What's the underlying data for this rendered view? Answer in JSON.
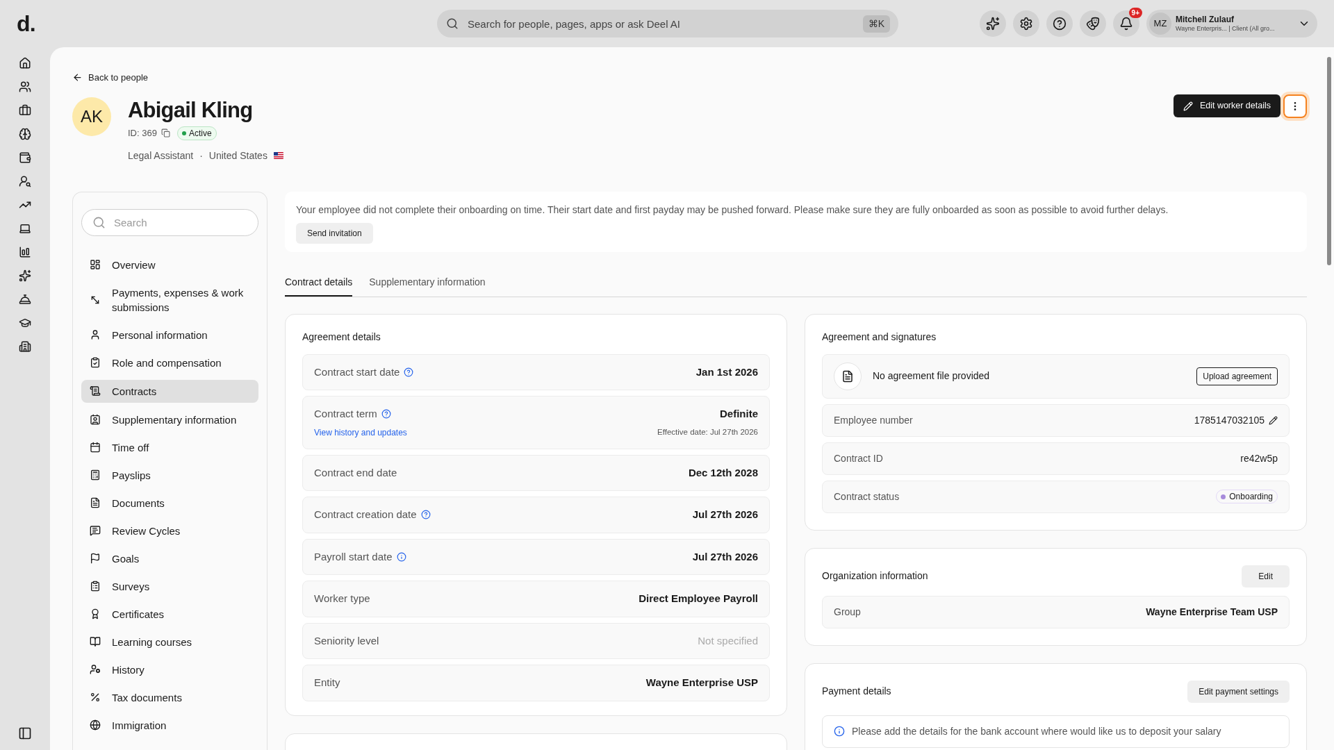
{
  "topbar": {
    "logo": "d.",
    "search_placeholder": "Search for people, pages, apps or ask Deel AI",
    "shortcut": "⌘K",
    "notification_badge": "9+",
    "user": {
      "initials": "MZ",
      "name": "Mitchell Zulauf",
      "subtitle": "Wayne Enterpris... | Client (All gro..."
    }
  },
  "header": {
    "back_link": "Back to people",
    "avatar_initials": "AK",
    "name": "Abigail Kling",
    "id": "ID: 369",
    "status": "Active",
    "role": "Legal Assistant",
    "separator": "·",
    "country": "United States",
    "edit_button": "Edit worker details"
  },
  "sidebar": {
    "search_placeholder": "Search",
    "items": [
      {
        "label": "Overview",
        "selected": false
      },
      {
        "label": "Payments, expenses & work submissions",
        "selected": false
      },
      {
        "label": "Personal information",
        "selected": false
      },
      {
        "label": "Role and compensation",
        "selected": false
      },
      {
        "label": "Contracts",
        "selected": true
      },
      {
        "label": "Supplementary information",
        "selected": false
      },
      {
        "label": "Time off",
        "selected": false
      },
      {
        "label": "Payslips",
        "selected": false
      },
      {
        "label": "Documents",
        "selected": false
      },
      {
        "label": "Review Cycles",
        "selected": false
      },
      {
        "label": "Goals",
        "selected": false
      },
      {
        "label": "Surveys",
        "selected": false
      },
      {
        "label": "Certificates",
        "selected": false
      },
      {
        "label": "Learning courses",
        "selected": false
      },
      {
        "label": "History",
        "selected": false
      },
      {
        "label": "Tax documents",
        "selected": false
      },
      {
        "label": "Immigration",
        "selected": false
      }
    ]
  },
  "alert": {
    "text": "Your employee did not complete their onboarding on time. Their start date and first payday may be pushed forward. Please make sure they are fully onboarded as soon as possible to avoid further delays.",
    "button": "Send invitation"
  },
  "tabs": [
    {
      "label": "Contract details",
      "selected": true
    },
    {
      "label": "Supplementary information",
      "selected": false
    }
  ],
  "agreement_details": {
    "title": "Agreement details",
    "rows": [
      {
        "label": "Contract start date",
        "kind": "help",
        "value": "Jan 1st 2026",
        "muted": false
      },
      {
        "label": "Contract term",
        "kind": "help",
        "value": "Definite",
        "link": "View history and updates",
        "note": "Effective date: Jul 27th 2026",
        "muted": false
      },
      {
        "label": "Contract end date",
        "kind": "plain",
        "value": "Dec 12th 2028",
        "muted": false
      },
      {
        "label": "Contract creation date",
        "kind": "help",
        "value": "Jul 27th 2026",
        "muted": false
      },
      {
        "label": "Payroll start date",
        "kind": "info",
        "value": "Jul 27th 2026",
        "muted": false
      },
      {
        "label": "Worker type",
        "kind": "plain",
        "value": "Direct Employee Payroll",
        "muted": false
      },
      {
        "label": "Seniority level",
        "kind": "plain",
        "value": "Not specified",
        "muted": true
      },
      {
        "label": "Entity",
        "kind": "plain",
        "value": "Wayne Enterprise USP",
        "muted": false
      }
    ]
  },
  "agreement_signatures": {
    "title": "Agreement and signatures",
    "file_text": "No agreement file provided",
    "upload_button": "Upload agreement",
    "rows": [
      {
        "label": "Employee number",
        "value": "1785147032105",
        "kind": "editable"
      },
      {
        "label": "Contract ID",
        "value": "re42w5p",
        "kind": "text"
      },
      {
        "label": "Contract status",
        "value": "Onboarding",
        "kind": "status",
        "color": "#a78bdb"
      }
    ]
  },
  "organization": {
    "title": "Organization information",
    "edit_button": "Edit",
    "rows": [
      {
        "label": "Group",
        "value": "Wayne Enterprise Team USP"
      }
    ]
  },
  "payment": {
    "title": "Payment details",
    "button": "Edit payment settings",
    "notice": "Please add the details for the bank account where would like us to deposit your salary"
  }
}
